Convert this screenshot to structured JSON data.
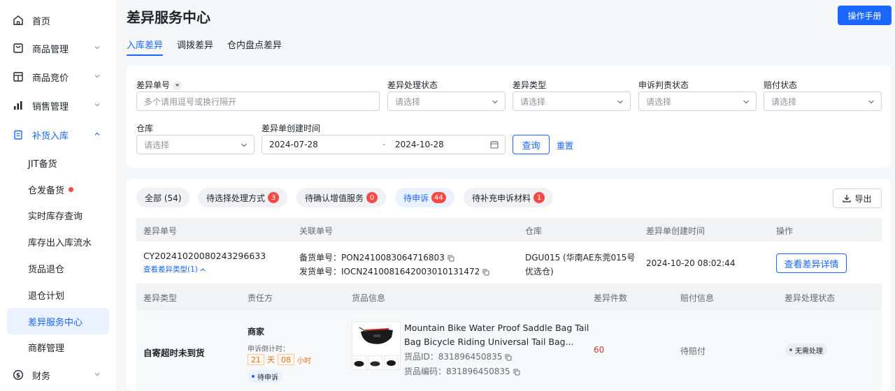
{
  "sidebar": {
    "items": [
      {
        "label": "首页",
        "icon": "home-icon"
      },
      {
        "label": "商品管理",
        "icon": "bag-icon"
      },
      {
        "label": "商品竞价",
        "icon": "store-icon"
      },
      {
        "label": "销售管理",
        "icon": "bar-chart-icon"
      },
      {
        "label": "补货入库",
        "icon": "clipboard-icon"
      },
      {
        "label": "财务",
        "icon": "dollar-icon"
      }
    ],
    "subitems": [
      "JIT备货",
      "仓发备货",
      "实时库存查询",
      "库存出入库流水",
      "货品退仓",
      "退仓计划",
      "差异服务中心",
      "商群管理"
    ]
  },
  "header": {
    "title": "差异服务中心",
    "manual_label": "操作手册"
  },
  "tabs": [
    "入库差异",
    "调拨差异",
    "仓内盘点差异"
  ],
  "filters": {
    "diff_no_label": "差异单号",
    "diff_no_placeholder": "多个请用逗号或换行隔开",
    "status_label": "差异处理状态",
    "type_label": "差异类型",
    "appeal_label": "申诉判责状态",
    "comp_label": "赔付状态",
    "warehouse_label": "仓库",
    "created_label": "差异单创建时间",
    "select_placeholder": "请选择",
    "date_start": "2024-07-28",
    "date_sep": "-",
    "date_end": "2024-10-28",
    "query_label": "查询",
    "reset_label": "重置"
  },
  "status_tabs": [
    {
      "label": "全部 (54)",
      "badge": ""
    },
    {
      "label": "待选择处理方式",
      "badge": "3"
    },
    {
      "label": "待确认增值服务",
      "badge": "0"
    },
    {
      "label": "待申诉",
      "badge": "44"
    },
    {
      "label": "待补充申诉材料",
      "badge": "1"
    }
  ],
  "export_label": "导出",
  "table": {
    "headers": [
      "差异单号",
      "关联单号",
      "仓库",
      "差异单创建时间",
      "操作"
    ],
    "row": {
      "diff_no": "CY20241020080243296633",
      "view_types": "查看差异类型(1)",
      "stock_no_label": "备货单号：",
      "stock_no": "PON2410083064716803",
      "ship_no_label": "发货单号：",
      "ship_no": "IOCN2410081642003010131472",
      "warehouse_line1": "DGU015 (华南AE东莞015号",
      "warehouse_line2": "优选仓)",
      "created": "2024-10-20 08:02:44",
      "detail_label": "查看差异详情"
    },
    "sub_headers": [
      "差异类型",
      "责任方",
      "货品信息",
      "差异件数",
      "赔付信息",
      "差异处理状态"
    ],
    "sub_row": {
      "diff_type": "自寄超时未到货",
      "responsible": "商家",
      "countdown_label": "申诉倒计时：",
      "days": "21",
      "days_unit": "天",
      "hours": "08",
      "hours_unit": "小时",
      "appeal_status": "待申诉",
      "product_name_1": "Mountain Bike Water Proof Saddle Bag Tail",
      "product_name_2": "Bag Bicycle Riding Universal Tail Bag...",
      "goods_id": "货品ID：831896450835",
      "goods_code": "货品编码：831896450835",
      "qty": "60",
      "comp": "待赔付",
      "process_status": "无需处理"
    }
  },
  "colors": {
    "primary": "#1a66ff",
    "danger": "#f54a45",
    "qty": "#d83931"
  }
}
